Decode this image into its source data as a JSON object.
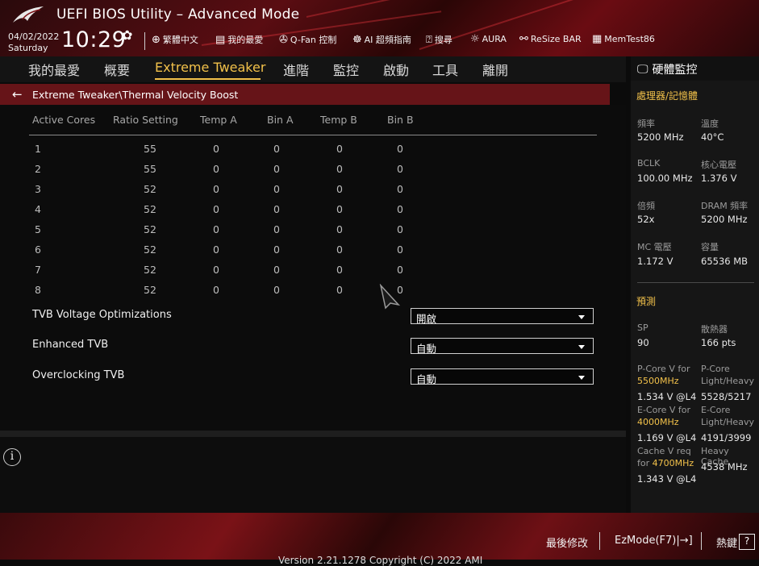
{
  "header": {
    "title": "UEFI BIOS Utility – Advanced Mode",
    "date": "04/02/2022",
    "day": "Saturday",
    "time": "10:29",
    "tools": [
      {
        "icon": "globe-icon",
        "label": "繁體中文"
      },
      {
        "icon": "favorites-icon",
        "label": "我的最愛"
      },
      {
        "icon": "fan-icon",
        "label": "Q-Fan 控制"
      },
      {
        "icon": "ai-icon",
        "label": "AI 超頻指南"
      },
      {
        "icon": "search-icon",
        "label": "搜尋"
      },
      {
        "icon": "aura-icon",
        "label": "AURA"
      },
      {
        "icon": "resize-bar-icon",
        "label": "ReSize BAR"
      },
      {
        "icon": "memtest-icon",
        "label": "MemTest86"
      }
    ]
  },
  "nav": {
    "tabs": [
      {
        "label": "我的最愛"
      },
      {
        "label": "概要"
      },
      {
        "label": "Extreme Tweaker"
      },
      {
        "label": "進階"
      },
      {
        "label": "監控"
      },
      {
        "label": "啟動"
      },
      {
        "label": "工具"
      },
      {
        "label": "離開"
      }
    ],
    "active": "Extreme Tweaker"
  },
  "breadcrumb": "Extreme Tweaker\\Thermal Velocity Boost",
  "table": {
    "headers": [
      "Active Cores",
      "Ratio Setting",
      "Temp A",
      "Bin A",
      "Temp B",
      "Bin B"
    ],
    "rows": [
      [
        "1",
        "55",
        "0",
        "0",
        "0",
        "0"
      ],
      [
        "2",
        "55",
        "0",
        "0",
        "0",
        "0"
      ],
      [
        "3",
        "52",
        "0",
        "0",
        "0",
        "0"
      ],
      [
        "4",
        "52",
        "0",
        "0",
        "0",
        "0"
      ],
      [
        "5",
        "52",
        "0",
        "0",
        "0",
        "0"
      ],
      [
        "6",
        "52",
        "0",
        "0",
        "0",
        "0"
      ],
      [
        "7",
        "52",
        "0",
        "0",
        "0",
        "0"
      ],
      [
        "8",
        "52",
        "0",
        "0",
        "0",
        "0"
      ]
    ]
  },
  "options": [
    {
      "label": "TVB Voltage Optimizations",
      "value": "開啟"
    },
    {
      "label": "Enhanced TVB",
      "value": "自動"
    },
    {
      "label": "Overclocking TVB",
      "value": "自動"
    }
  ],
  "hw": {
    "title": "硬體監控",
    "section1": "處理器/記憶體",
    "freq_label": "頻率",
    "freq": "5200 MHz",
    "temp_label": "溫度",
    "temp": "40°C",
    "bclk_label": "BCLK",
    "bclk": "100.00 MHz",
    "corev_label": "核心電壓",
    "corev": "1.376 V",
    "ratio_label": "倍頻",
    "ratio": "52x",
    "dram_label": "DRAM 頻率",
    "dram": "5200 MHz",
    "mcv_label": "MC 電壓",
    "mcv": "1.172 V",
    "cap_label": "容量",
    "cap": "65536 MB",
    "section2": "預測",
    "sp_label": "SP",
    "sp": "90",
    "cooler_label": "散熱器",
    "cooler": "166 pts",
    "pcorev_label": "P-Core V for",
    "pcorev_freq": "5500MHz",
    "pcorev": "1.534 V @L4",
    "pcore_lh_label1": "P-Core",
    "pcore_lh_label2": "Light/Heavy",
    "pcore_lh": "5528/5217",
    "ecorev_label": "E-Core V for",
    "ecorev_freq": "4000MHz",
    "ecorev": "1.169 V @L4",
    "ecore_lh_label1": "E-Core",
    "ecore_lh_label2": "Light/Heavy",
    "ecore_lh": "4191/3999",
    "cachev_label1": "Cache V req",
    "cachev_label2": "for",
    "cachev_freq": "4700MHz",
    "cachev": "1.343 V @L4",
    "heavycache_label": "Heavy Cache",
    "heavycache": "4538 MHz"
  },
  "bottom": {
    "last_modified": "最後修改",
    "ezmode": "EzMode(F7)|→]",
    "hotkeys": "熱鍵",
    "help_key": "?",
    "version": "Version 2.21.1278 Copyright (C) 2022 AMI"
  }
}
